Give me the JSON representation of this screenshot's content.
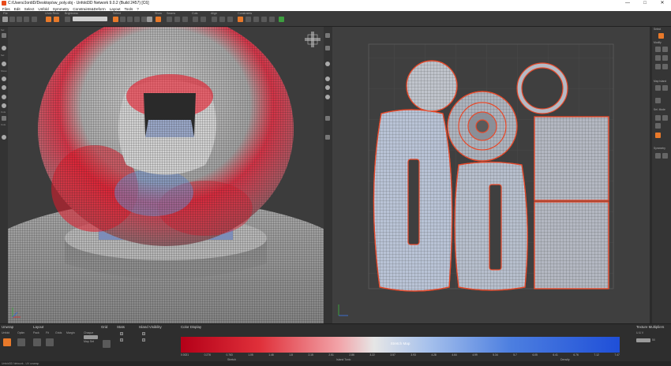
{
  "window": {
    "title": "C:/Users/JordiD/Desktop/sw_poly.obj - Unfold3D Network 9.0.2 (Build 2457) [C6]",
    "controls": [
      "—",
      "□",
      "✕"
    ]
  },
  "menu": [
    "Files",
    "Edit",
    "Select",
    "Unfold",
    "Symmetry",
    "Constraints&Deform",
    "Layout",
    "Tools",
    "?"
  ],
  "toolbar": {
    "groups": [
      "File",
      "Undo Redo",
      "Brightness",
      "Select",
      "Show",
      "Seams",
      "Cuts",
      "Align",
      "Constraints"
    ]
  },
  "left_strip": {
    "labels": [
      "Sel",
      "Sel",
      "Show",
      "Cuts",
      "Cuts"
    ]
  },
  "viewports": {
    "left": "3D view",
    "right": "UV view"
  },
  "right_panel": {
    "labels": [
      "Select",
      "Modify",
      "Map Island",
      "Sel. Mode",
      "Symmetry"
    ]
  },
  "bottom": {
    "sections": [
      {
        "name": "Unwrap",
        "items": [
          "Unfold",
          "Optim",
          "Pack",
          "Fit",
          "Grids",
          "Margin"
        ]
      },
      {
        "name": "Layout",
        "items": [
          "Chaque",
          "Map Set"
        ]
      },
      {
        "name": "Grid",
        "items": []
      },
      {
        "name": "Stats",
        "items": []
      },
      {
        "name": "Island Visibility",
        "items": []
      },
      {
        "name": "Color Display",
        "items": []
      },
      {
        "name": "Texture Multipliers",
        "items": [
          "U & V"
        ]
      }
    ],
    "stretch_map_label": "Stretch Map",
    "stretch_scale": [
      "0.0021",
      "0.276",
      "0.763",
      "1.05",
      "1.46",
      "1.8",
      "2.15",
      "2.51",
      "2.86",
      "3.22",
      "3.57",
      "3.93",
      "4.28",
      "4.64",
      "4.99",
      "5.34",
      "5.7",
      "6.05",
      "6.41",
      "6.76",
      "7.12",
      "7.47"
    ],
    "options": [
      "Stretch",
      "Island Tonic",
      "Density"
    ],
    "texture_value": "50"
  },
  "status": {
    "left": "Unfold3D Network - UV unwrap",
    "right": ""
  },
  "colors": {
    "accent": "#e8792a",
    "seam": "#e8492a",
    "stretch_red": "#c8001a",
    "stretch_blue": "#1f4fd8"
  }
}
